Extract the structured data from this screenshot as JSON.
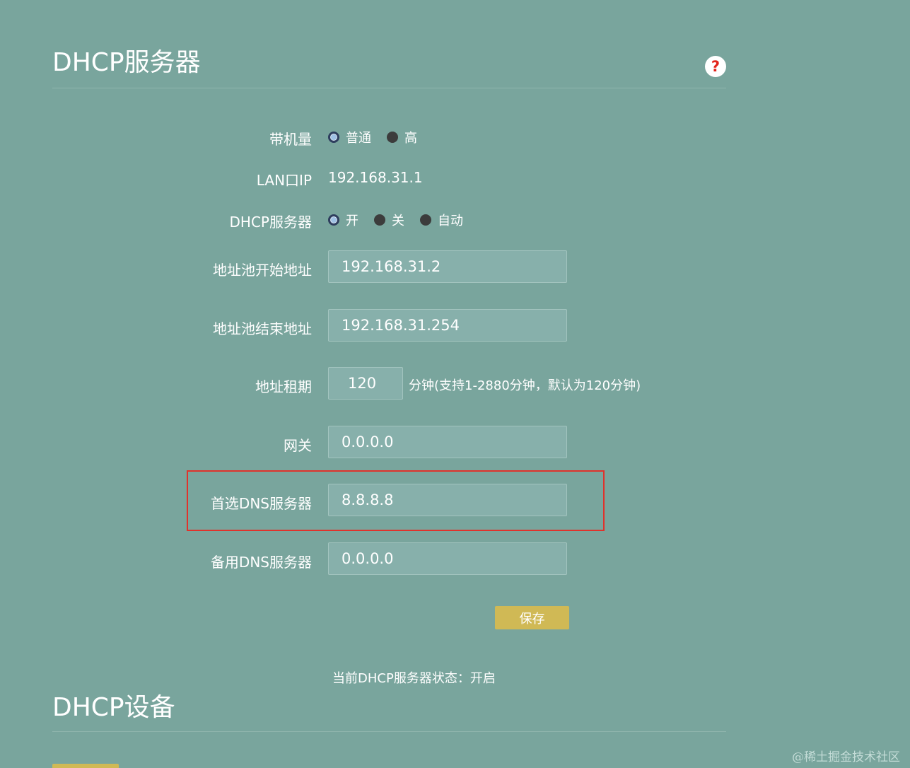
{
  "dhcp_server": {
    "title": "DHCP服务器",
    "help_icon": "?",
    "load": {
      "label": "带机量",
      "options": [
        "普通",
        "高"
      ],
      "selected": "普通"
    },
    "lan_ip": {
      "label": "LAN口IP",
      "value": "192.168.31.1"
    },
    "dhcp_mode": {
      "label": "DHCP服务器",
      "options": [
        "开",
        "关",
        "自动"
      ],
      "selected": "开"
    },
    "pool_start": {
      "label": "地址池开始地址",
      "value": "192.168.31.2"
    },
    "pool_end": {
      "label": "地址池结束地址",
      "value": "192.168.31.254"
    },
    "lease": {
      "label": "地址租期",
      "value": "120",
      "hint": "分钟(支持1-2880分钟，默认为120分钟)"
    },
    "gateway": {
      "label": "网关",
      "value": "0.0.0.0"
    },
    "primary_dns": {
      "label": "首选DNS服务器",
      "value": "8.8.8.8"
    },
    "secondary_dns": {
      "label": "备用DNS服务器",
      "value": "0.0.0.0"
    },
    "save_label": "保存",
    "status_text": "当前DHCP服务器状态：开启"
  },
  "dhcp_devices": {
    "title": "DHCP设备"
  },
  "watermark": "@稀土掘金技术社区",
  "colors": {
    "background": "#79a59d",
    "field_bg": "#87b0ab",
    "accent_button": "#d0b955",
    "highlight_border": "#e0322c",
    "help_icon_color": "#e2231a"
  }
}
